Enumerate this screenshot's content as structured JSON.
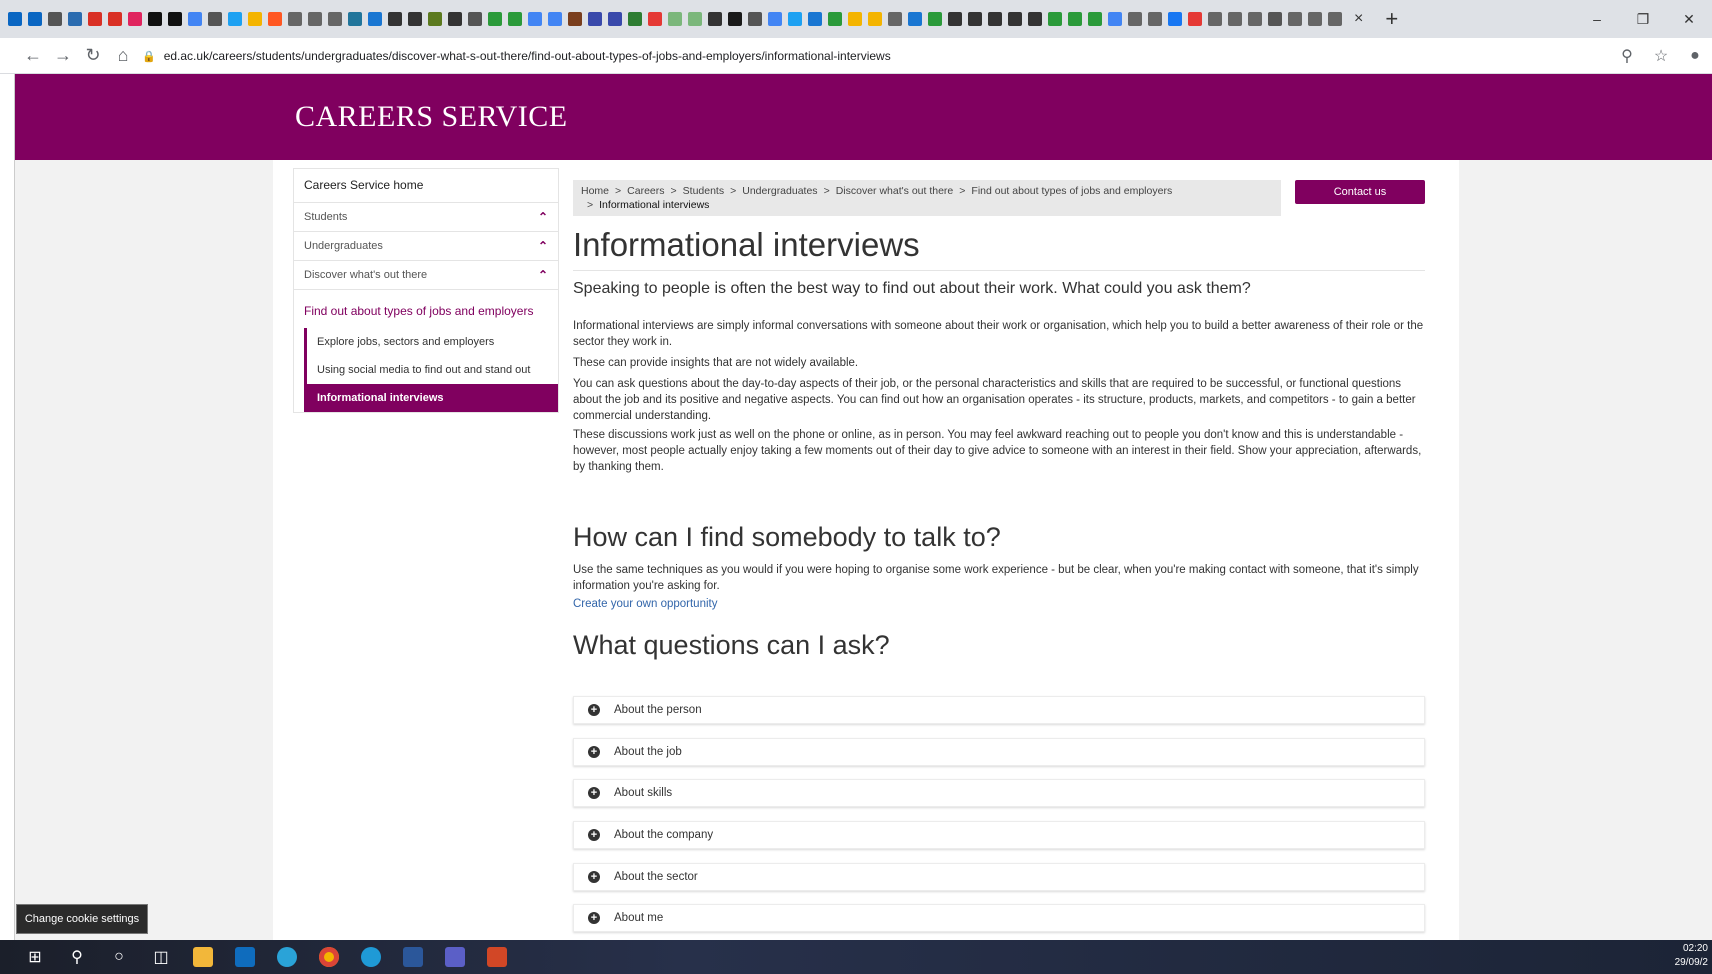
{
  "browser": {
    "url": "ed.ac.uk/careers/students/undergraduates/discover-what-s-out-there/find-out-about-types-of-jobs-and-employers/informational-interviews",
    "tab_close": "×",
    "new_tab": "+",
    "tab_favicon_colors": [
      "#0a66c2",
      "#0a66c2",
      "#555",
      "#2b6cb0",
      "#d93025",
      "#d93025",
      "#e0245e",
      "#111",
      "#111",
      "#4285f4",
      "#555",
      "#1da1f2",
      "#f4b400",
      "#ff5722",
      "#666",
      "#666",
      "#666",
      "#21759b",
      "#1976d2",
      "#333",
      "#333",
      "#5c7a1f",
      "#333",
      "#555",
      "#2b9a3a",
      "#2b9a3a",
      "#4285f4",
      "#4285f4",
      "#7a3e1d",
      "#3949ab",
      "#3949ab",
      "#2e7d32",
      "#e53935",
      "#7bb77b",
      "#7bb77b",
      "#333",
      "#1a1a1a",
      "#555",
      "#4285f4",
      "#1da1f2",
      "#1976d2",
      "#2b9a3a",
      "#f4b400",
      "#f4b400",
      "#666",
      "#1976d2",
      "#2b9a3a",
      "#333",
      "#333",
      "#333",
      "#333",
      "#333",
      "#2b9a3a",
      "#2b9a3a",
      "#2b9a3a",
      "#4285f4",
      "#666",
      "#666",
      "#1877f2",
      "#e53935",
      "#666",
      "#666",
      "#666",
      "#555",
      "#666",
      "#666",
      "#666"
    ],
    "omni_icons": [
      "zoom-icon",
      "star-icon",
      "profile-icon"
    ]
  },
  "site": {
    "title": "CAREERS SERVICE"
  },
  "sidebar": {
    "home": "Careers Service home",
    "sections": [
      "Students",
      "Undergraduates",
      "Discover what's out there"
    ],
    "current": "Find out about types of jobs and employers",
    "sub_items": [
      "Explore jobs, sectors and employers",
      "Using social media to find out and stand out",
      "Informational interviews"
    ],
    "active_index": 2
  },
  "breadcrumb": {
    "items": [
      "Home",
      "Careers",
      "Students",
      "Undergraduates",
      "Discover what's out there",
      "Find out about types of jobs and employers"
    ],
    "last": "Informational interviews",
    "separator": ">"
  },
  "contact_button": "Contact us",
  "main": {
    "title": "Informational interviews",
    "lead": "Speaking to people is often the best way to find out about their work. What could you ask them?",
    "paragraphs": [
      "Informational interviews are simply informal conversations with someone about their work or organisation, which help you to build a better awareness of their role or the sector they work in.",
      "These can provide insights that are not widely available.",
      "You can ask questions about the day-to-day aspects of their job, or the personal characteristics and skills that are required to be successful, or functional questions about the job and its positive and negative aspects. You can find out how an organisation operates - its structure, products, markets, and competitors - to gain a better commercial understanding.",
      "These discussions work just as well on the phone or online, as in person. You may feel awkward reaching out to people you don't know and this is understandable - however, most people actually enjoy taking a few moments out of their day to give advice to someone with an interest in their field. Show your appreciation, afterwards, by thanking them."
    ],
    "h2_find": "How can I find somebody to talk to?",
    "find_text": "Use the same techniques as you would if you were hoping to organise some work experience - but be clear, when you're making contact with someone, that it's simply information you're asking for.",
    "find_link": "Create your own opportunity",
    "h2_questions": "What questions can I ask?",
    "accordion": [
      "About the person",
      "About the job",
      "About skills",
      "About the company",
      "About the sector",
      "About me"
    ]
  },
  "cookie_button": "Change cookie settings",
  "taskbar": {
    "time": "02:20",
    "date": "29/09/2"
  },
  "colors": {
    "brand": "#80005f",
    "link": "#3366aa"
  }
}
